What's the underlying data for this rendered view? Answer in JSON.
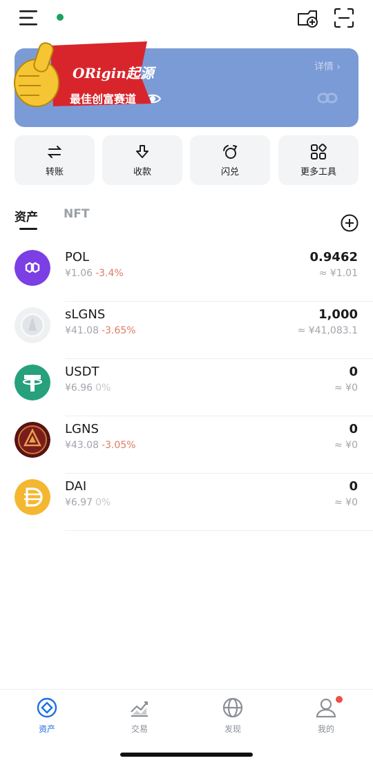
{
  "header": {
    "menu_icon": "hamburger-menu-icon",
    "status_color": "#1aa35d",
    "wallet_add_icon": "wallet-add-icon",
    "scan_icon": "scan-icon"
  },
  "banner": {
    "detail_label": "详情 ›",
    "promo_title": "ORigin起源",
    "promo_subtitle": "最佳创富赛道",
    "background": "#7b9bd6"
  },
  "actions": [
    {
      "label": "转账",
      "icon": "transfer-icon"
    },
    {
      "label": "收款",
      "icon": "receive-icon"
    },
    {
      "label": "闪兑",
      "icon": "swap-icon"
    },
    {
      "label": "更多工具",
      "icon": "more-tools-icon"
    }
  ],
  "tabs": {
    "assets": "资产",
    "nft": "NFT"
  },
  "tokens": [
    {
      "symbol": "POL",
      "price": "¥1.06",
      "change": "-3.4%",
      "balance": "0.9462",
      "value": "≈ ¥1.01",
      "color": "#7b3fe4"
    },
    {
      "symbol": "sLGNS",
      "price": "¥41.08",
      "change": "-3.65%",
      "balance": "1,000",
      "value": "≈ ¥41,083.1",
      "color": "#e6e8ea"
    },
    {
      "symbol": "USDT",
      "price": "¥6.96",
      "change": "0%",
      "balance": "0",
      "value": "≈ ¥0",
      "color": "#26a17b"
    },
    {
      "symbol": "LGNS",
      "price": "¥43.08",
      "change": "-3.05%",
      "balance": "0",
      "value": "≈ ¥0",
      "color": "#7a1c1c"
    },
    {
      "symbol": "DAI",
      "price": "¥6.97",
      "change": "0%",
      "balance": "0",
      "value": "≈ ¥0",
      "color": "#f4b731"
    }
  ],
  "nav": [
    {
      "label": "资产",
      "icon": "assets-icon",
      "active": true
    },
    {
      "label": "交易",
      "icon": "trade-chart-icon",
      "active": false
    },
    {
      "label": "发现",
      "icon": "discover-globe-icon",
      "active": false
    },
    {
      "label": "我的",
      "icon": "profile-icon",
      "active": false
    }
  ],
  "colors": {
    "accent": "#1a6fe0",
    "negative_change": "#e07a62",
    "notification": "#f04e47"
  }
}
